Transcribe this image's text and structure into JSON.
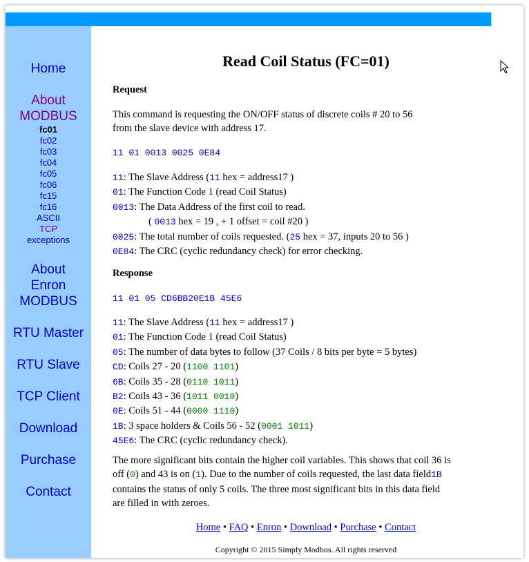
{
  "nav": {
    "home": "Home",
    "about_line1": "About",
    "about_line2": "MODBUS",
    "sub": [
      "fc01",
      "fc02",
      "fc03",
      "fc04",
      "fc05",
      "fc06",
      "fc15",
      "fc16",
      "ASCII",
      "TCP",
      "exceptions"
    ],
    "enron_line1": "About",
    "enron_line2": "Enron",
    "enron_line3": "MODBUS",
    "rtu_master": "RTU Master",
    "rtu_slave": "RTU Slave",
    "tcp_client": "TCP Client",
    "download": "Download",
    "purchase": "Purchase",
    "contact": "Contact"
  },
  "page": {
    "title": "Read Coil Status (FC=01)",
    "request_heading": "Request",
    "request_desc_1": "This command is requesting the ON/OFF status of discrete coils # 20 to 56",
    "request_desc_2": "from the slave device with address 17.",
    "request_hex": "11 01 0013 0025 0E84",
    "req": {
      "c1": "11",
      "t1a": ": The Slave Address (",
      "c1b": "11",
      "t1b": " hex = address17 )",
      "c2": "01",
      "t2": ": The Function Code 1 (read Coil Status)",
      "c3": "0013",
      "t3": ": The Data Address of the first coil to read.",
      "t3b_pre": "( ",
      "c3b": "0013",
      "t3b": " hex = 19 , + 1 offset = coil #20 )",
      "c4": "0025",
      "t4a": ": The total number of coils requested.  (",
      "c4b": "25",
      "t4b": " hex = 37,  inputs 20 to 56 )",
      "c5": "0E84",
      "t5": ": The CRC (cyclic redundancy check) for error checking."
    },
    "response_heading": "Response",
    "response_hex": "11 01 05 CD6BB20E1B 45E6",
    "resp": {
      "c1": "11",
      "t1a": ": The Slave Address (",
      "c1b": "11",
      "t1b": " hex = address17 )",
      "c2": "01",
      "t2": ": The Function Code 1 (read Coil Status)",
      "c3": "05",
      "t3": ": The number of data bytes to follow (37 Coils / 8 bits per byte = 5 bytes)",
      "c4": "CD",
      "t4": ": Coils 27 - 20 (",
      "b4": "1100 1101",
      "e4": ")",
      "c5": "6B",
      "t5": ": Coils 35 - 28 (",
      "b5": "0110 1011",
      "e5": ")",
      "c6": "B2",
      "t6": ": Coils 43 - 36 (",
      "b6": "1011 0010",
      "e6": ")",
      "c7": "0E",
      "t7": ": Coils 51 - 44 (",
      "b7": "0000 1110",
      "e7": ")",
      "c8": "1B",
      "t8": ": 3 space holders & Coils 56 - 52 (",
      "b8": "0001 1011",
      "e8": ")",
      "c9": "45E6",
      "t9": ": The CRC (cyclic redundancy check)."
    },
    "note": {
      "p1": "The more significant bits contain the higher coil variables. This shows that coil 36 is",
      "p2a": "off (",
      "z": "0",
      "p2b": ") and 43 is on (",
      "o": "1",
      "p2c": "). Due to the number of coils requested, the last data field",
      "f": "1B",
      "p3": "contains the status of only 5 coils.  The three most significant bits in this data field",
      "p4": "are filled in with zeroes."
    },
    "footer_links": [
      "Home",
      "FAQ",
      "Enron",
      "Download",
      "Purchase",
      "Contact"
    ],
    "footer_sep": " • ",
    "copyright": "Copyright © 2015 Simply Modbus. All rights reserved"
  }
}
